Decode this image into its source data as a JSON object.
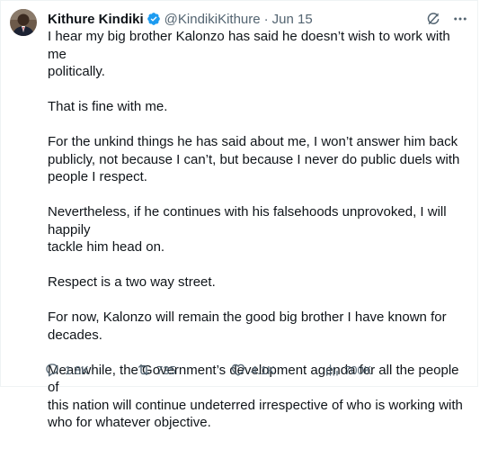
{
  "author": {
    "display_name": "Kithure Kindiki",
    "handle": "@KindikiKithure",
    "separator": "·",
    "date": "Jun 15",
    "verified": true
  },
  "tweet": {
    "paragraphs": [
      "I hear my big brother Kalonzo has said he doesn’t wish to work with me\npolitically.",
      "That is fine with me.",
      "For the unkind things he has said about me, I won’t answer him back\npublicly, not because I can’t, but because I never do public duels with\npeople  I respect.",
      "Nevertheless, if he continues with his falsehoods unprovoked, I will happily\ntackle him head on.",
      "Respect is a two way street.",
      "For now, Kalonzo will remain  the good big brother I have known for\ndecades.",
      "Meanwhile, the Government’s development agenda for all the people of\nthis  nation will continue undeterred irrespective of who is working with\nwho for whatever objective."
    ]
  },
  "stats": {
    "replies": "1.8K",
    "reposts": "735",
    "likes": "4.1K",
    "views": "700K"
  },
  "icons": {
    "verified": "verified-badge-icon",
    "grok": "grok-icon",
    "more": "more-icon",
    "reply": "reply-icon",
    "repost": "repost-icon",
    "like": "heart-icon",
    "views": "views-chart-icon",
    "bookmark": "bookmark-icon",
    "share": "share-icon"
  },
  "colors": {
    "text": "#0f1419",
    "secondary": "#536471",
    "verified": "#1d9bf0"
  }
}
